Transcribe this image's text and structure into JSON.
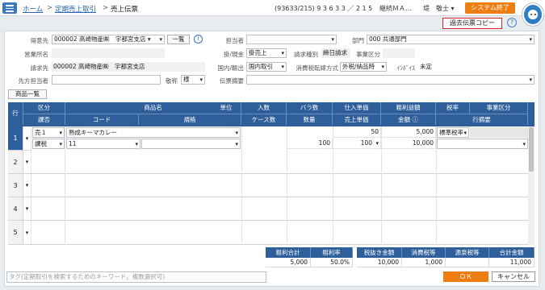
{
  "breadcrumb": {
    "home": "ホーム",
    "sep1": ">",
    "parent": "定期売上取引",
    "sep2": ">",
    "current": "売上伝票"
  },
  "header": {
    "user_info": "(93633/215) 9 3 6 3 3 ／ 2 1 5",
    "company": "継続ＭＡ…",
    "user_name": "堤　敬士 ▾",
    "system_exit": "システム終了"
  },
  "toolbar": {
    "copy_past": "過去伝票コピー",
    "help": "?"
  },
  "form": {
    "tokuisaki_label": "得意先",
    "tokuisaki_value": "000002 高崎物産㈱　宇都宮支店 ▾",
    "list_button": "一覧",
    "info": "i",
    "eigyo_label": "営業所名",
    "eigyo_value": "",
    "seikyu_label": "請求先",
    "seikyu_value": "000002 高崎物産㈱　宇都宮支店",
    "sakitanto_label": "先方担当者",
    "sakitanto_value": "",
    "keisho_label": "敬称",
    "keisho_value": "様",
    "tanto_label": "担当者",
    "tanto_value": "",
    "bumon_label": "部門",
    "bumon_value": "000 共通部門",
    "kake_label": "掛/現金",
    "kake_value": "掛売上",
    "seikyu_shubetsu_label": "請求種別",
    "seikyu_shubetsu_value": "締日請求",
    "jigyo_label": "事業区分",
    "jigyo_value": "",
    "kokunai_label": "国内/輸出",
    "kokunai_value": "国内取引",
    "zei_label": "消費税転嫁方式",
    "zei_value": "外税/納品時",
    "invoice_label": "ｲﾝﾎﾞｲｽ",
    "invoice_value": "未定",
    "tekiyo_label": "伝票摘要",
    "tekiyo_value": ""
  },
  "product_list_button": "商品一覧",
  "grid": {
    "header1": [
      "行",
      "区分",
      "商品名",
      "単位",
      "入数",
      "バラ数",
      "仕入単価",
      "粗利益額",
      "税率",
      "事業区分"
    ],
    "header2": [
      "課否",
      "コード",
      "規格",
      "ケース数",
      "数量",
      "売上単価",
      "金額 ⓘ",
      "行摘要"
    ],
    "rows": [
      {
        "no": "1",
        "kubun": "売１",
        "name": "熟成キーマカレー",
        "tani": "",
        "irisu": "",
        "bara": "",
        "shiire": "50",
        "arari": "5,000",
        "zeiritsu": "標準税率",
        "jigyo": ""
      },
      {
        "no": "2"
      },
      {
        "no": "3"
      },
      {
        "no": "4"
      },
      {
        "no": "5"
      }
    ],
    "row1_line2": {
      "kahi": "課税",
      "code": "11",
      "kikaku": "",
      "case": "",
      "suryo": "100",
      "uriage": "100",
      "kingaku": "10,000",
      "gyo_tekiyo": ""
    }
  },
  "summary": {
    "left_headers": [
      "粗利合計",
      "粗利率"
    ],
    "left_values": [
      "5,000",
      "50.0%"
    ],
    "right_headers": [
      "税抜き金額",
      "消費税等",
      "源泉税等",
      "合計金額"
    ],
    "right_values": [
      "10,000",
      "1,000",
      "",
      "11,000"
    ]
  },
  "tag_placeholder": "タグ(定期取引を検索するためのキーワード。複数選択可)",
  "ok": "ＯＫ",
  "cancel": "キャンセル",
  "colors": {
    "accent": "#ee7d12",
    "header_blue": "#2f5f9b",
    "highlight_red": "#d8232a"
  }
}
